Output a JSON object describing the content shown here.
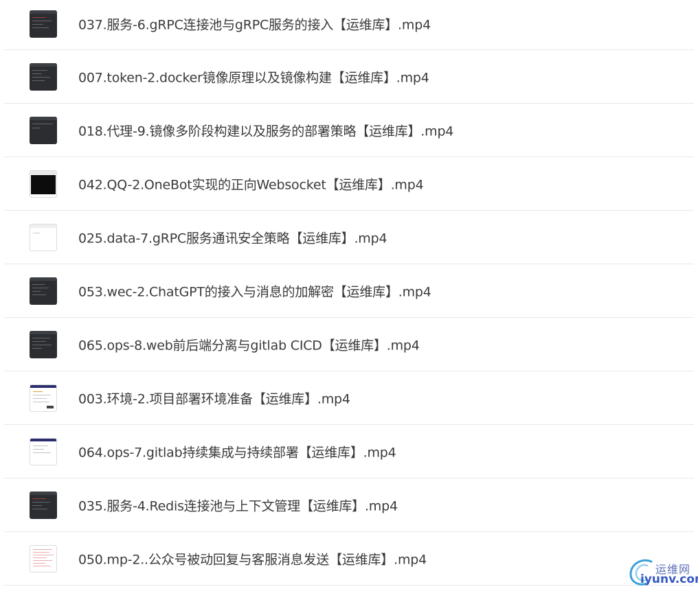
{
  "files": [
    {
      "name": "037.服务-6.gRPC连接池与gRPC服务的接入【运维库】.mp4",
      "thumb": "dark"
    },
    {
      "name": "007.token-2.docker镜像原理以及镜像构建【运维库】.mp4",
      "thumb": "dark"
    },
    {
      "name": "018.代理-9.镜像多阶段构建以及服务的部署策略【运维库】.mp4",
      "thumb": "dark"
    },
    {
      "name": "042.QQ-2.OneBot实现的正向Websocket【运维库】.mp4",
      "thumb": "terminal"
    },
    {
      "name": "025.data-7.gRPC服务通讯安全策略【运维库】.mp4",
      "thumb": "light"
    },
    {
      "name": "053.wec-2.ChatGPT的接入与消息的加解密【运维库】.mp4",
      "thumb": "dark"
    },
    {
      "name": "065.ops-8.web前后端分离与gitlab CICD【运维库】.mp4",
      "thumb": "dark"
    },
    {
      "name": "003.环境-2.项目部署环境准备【运维库】.mp4",
      "thumb": "web"
    },
    {
      "name": "064.ops-7.gitlab持续集成与持续部署【运维库】.mp4",
      "thumb": "web"
    },
    {
      "name": "035.服务-4.Redis连接池与上下文管理【运维库】.mp4",
      "thumb": "dark"
    },
    {
      "name": "050.mp-2..公众号被动回复与客服消息发送【运维库】.mp4",
      "thumb": "doc"
    }
  ],
  "watermark": {
    "title": "运维网",
    "domain": "iyunv.com"
  },
  "icons": {
    "thumbnail": "video-thumbnail-icon",
    "logo": "iyunv-logo-icon"
  }
}
